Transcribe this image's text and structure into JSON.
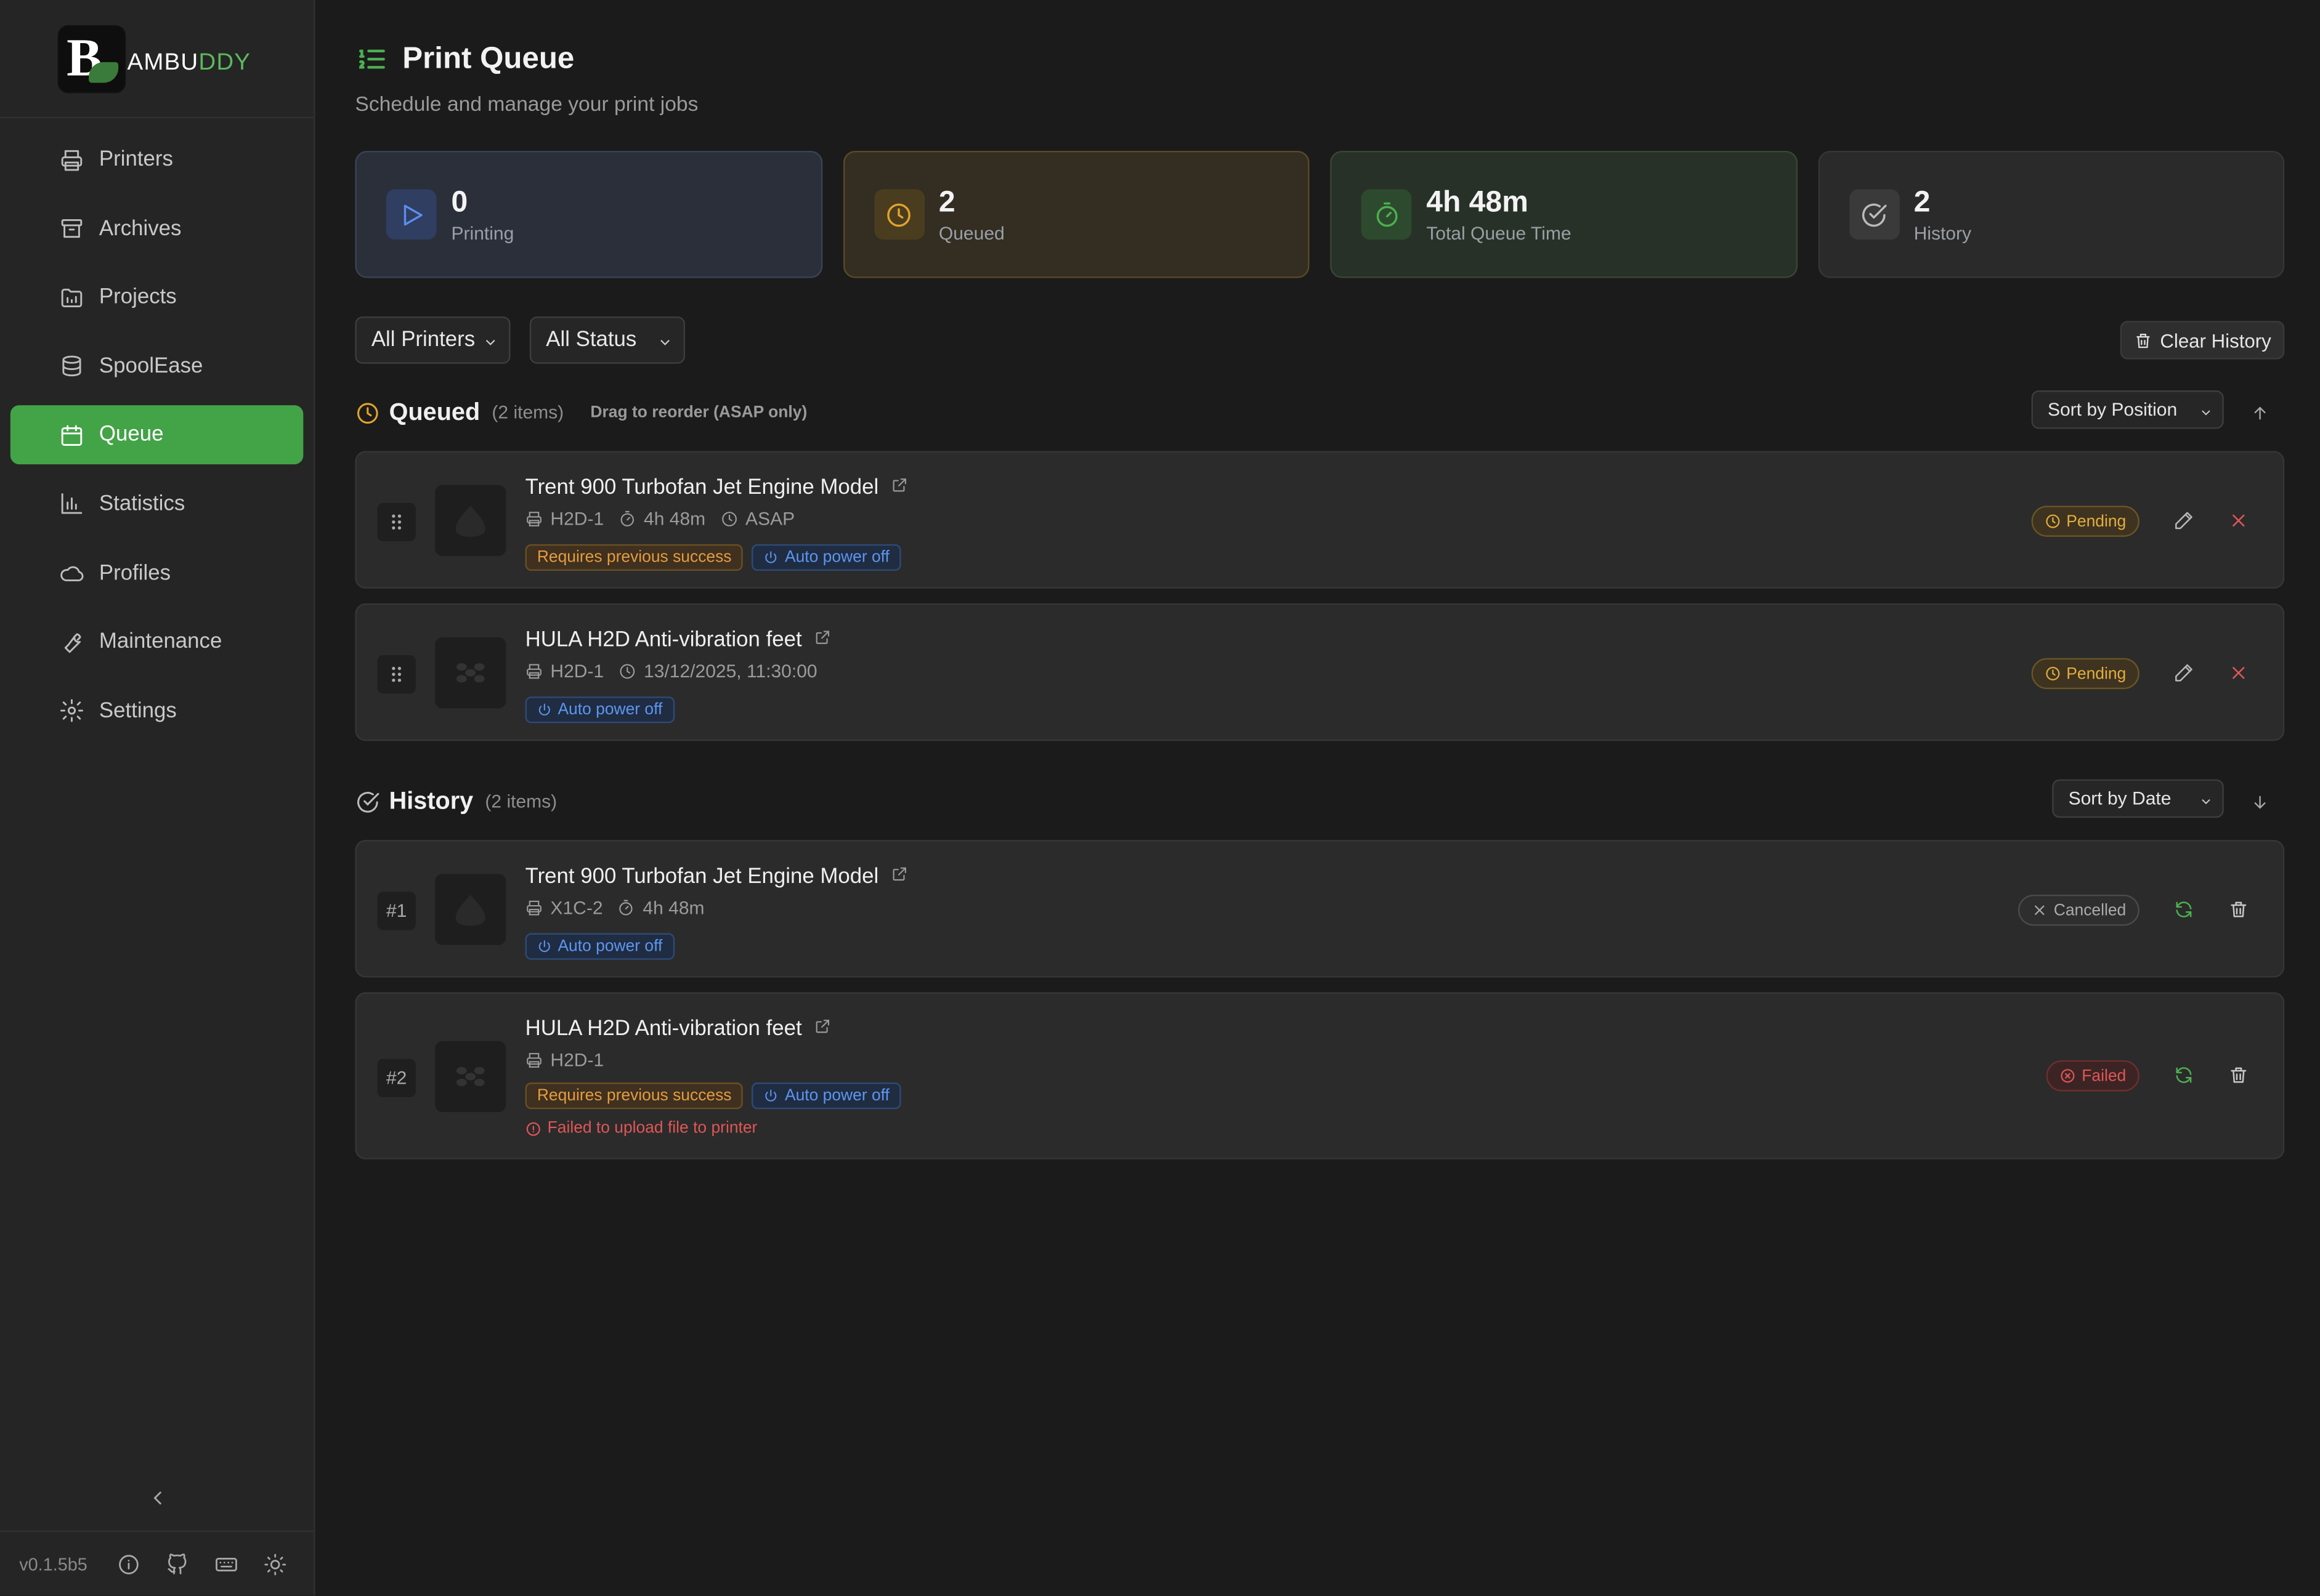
{
  "app": {
    "logo_text_a": "AMBU",
    "logo_text_b": "DDY",
    "version": "v0.1.5b5"
  },
  "sidebar": {
    "items": [
      {
        "label": "Printers",
        "icon": "printer-icon"
      },
      {
        "label": "Archives",
        "icon": "archive-icon"
      },
      {
        "label": "Projects",
        "icon": "folder-icon"
      },
      {
        "label": "SpoolEase",
        "icon": "spool-icon"
      },
      {
        "label": "Queue",
        "icon": "calendar-icon",
        "active": true
      },
      {
        "label": "Statistics",
        "icon": "chart-icon"
      },
      {
        "label": "Profiles",
        "icon": "cloud-icon"
      },
      {
        "label": "Maintenance",
        "icon": "wrench-icon"
      },
      {
        "label": "Settings",
        "icon": "gear-icon"
      }
    ]
  },
  "header": {
    "title": "Print Queue",
    "subtitle": "Schedule and manage your print jobs"
  },
  "stats": [
    {
      "value": "0",
      "label": "Printing"
    },
    {
      "value": "2",
      "label": "Queued"
    },
    {
      "value": "4h 48m",
      "label": "Total Queue Time"
    },
    {
      "value": "2",
      "label": "History"
    }
  ],
  "filters": {
    "printer": "All Printers",
    "status": "All Status",
    "clear_label": "Clear History"
  },
  "queued": {
    "title": "Queued",
    "count": "(2 items)",
    "hint": "Drag to reorder (ASAP only)",
    "sort": "Sort by Position",
    "items": [
      {
        "name": "Trent 900 Turbofan Jet Engine Model",
        "printer": "H2D-1",
        "duration": "4h 48m",
        "schedule": "ASAP",
        "tag_prev": "Requires previous success",
        "tag_power": "Auto power off",
        "status": "Pending"
      },
      {
        "name": "HULA H2D Anti-vibration feet",
        "printer": "H2D-1",
        "schedule": "13/12/2025, 11:30:00",
        "tag_power": "Auto power off",
        "status": "Pending"
      }
    ]
  },
  "history": {
    "title": "History",
    "count": "(2 items)",
    "sort": "Sort by Date",
    "items": [
      {
        "index": "#1",
        "name": "Trent 900 Turbofan Jet Engine Model",
        "printer": "X1C-2",
        "duration": "4h 48m",
        "tag_power": "Auto power off",
        "status": "Cancelled"
      },
      {
        "index": "#2",
        "name": "HULA H2D Anti-vibration feet",
        "printer": "H2D-1",
        "tag_prev": "Requires previous success",
        "tag_power": "Auto power off",
        "error": "Failed to upload file to printer",
        "status": "Failed"
      }
    ]
  },
  "colors": {
    "accent": "#43a347",
    "pending": "#e4ad3d",
    "failed": "#e05656",
    "info": "#5d96f0"
  }
}
